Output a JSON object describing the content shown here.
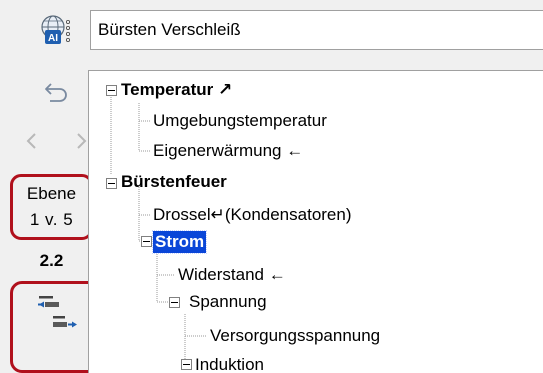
{
  "header": {
    "title_value": "Bürsten Verschleiß",
    "ai_icon_text": "AI"
  },
  "sidebar": {
    "level_label": "Ebene",
    "level_value": "1 v. 5",
    "level_number": "2.2"
  },
  "tree": {
    "nodes": [
      {
        "label": "Temperatur",
        "suffix": " ↗",
        "bold": true
      },
      {
        "label": "Umgebungstemperatur"
      },
      {
        "label": "Eigenerwärmung ←"
      },
      {
        "label": "Bürstenfeuer",
        "bold": true
      },
      {
        "label": "Drossel↵(Kondensatoren)"
      },
      {
        "label": "Strom",
        "bold": true,
        "selected": true
      },
      {
        "label": "Widerstand ←"
      },
      {
        "label": "Spannung"
      },
      {
        "label": "Versorgungsspannung"
      },
      {
        "label": "Induktion"
      }
    ]
  },
  "colors": {
    "highlight_border": "#b0101c",
    "selection": "#0a46d8",
    "icon_blue": "#1f5fb0"
  }
}
